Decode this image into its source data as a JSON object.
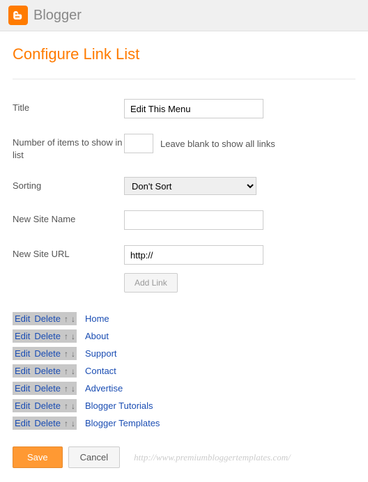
{
  "header": {
    "brand": "Blogger"
  },
  "page": {
    "title": "Configure Link List"
  },
  "form": {
    "title_label": "Title",
    "title_value": "Edit This Menu",
    "items_label": "Number of items to show in list",
    "items_value": "",
    "items_hint": "Leave blank to show all links",
    "sorting_label": "Sorting",
    "sorting_value": "Don't Sort",
    "site_name_label": "New Site Name",
    "site_name_value": "",
    "site_url_label": "New Site URL",
    "site_url_value": "http://",
    "add_link_btn": "Add Link"
  },
  "link_controls": {
    "edit": "Edit",
    "delete": "Delete",
    "up": "↑",
    "down": "↓"
  },
  "links": [
    {
      "name": "Home"
    },
    {
      "name": "About"
    },
    {
      "name": "Support"
    },
    {
      "name": "Contact"
    },
    {
      "name": "Advertise"
    },
    {
      "name": "Blogger Tutorials"
    },
    {
      "name": "Blogger Templates"
    }
  ],
  "footer": {
    "save": "Save",
    "cancel": "Cancel",
    "watermark": "http://www.premiumbloggertemplates.com/"
  }
}
